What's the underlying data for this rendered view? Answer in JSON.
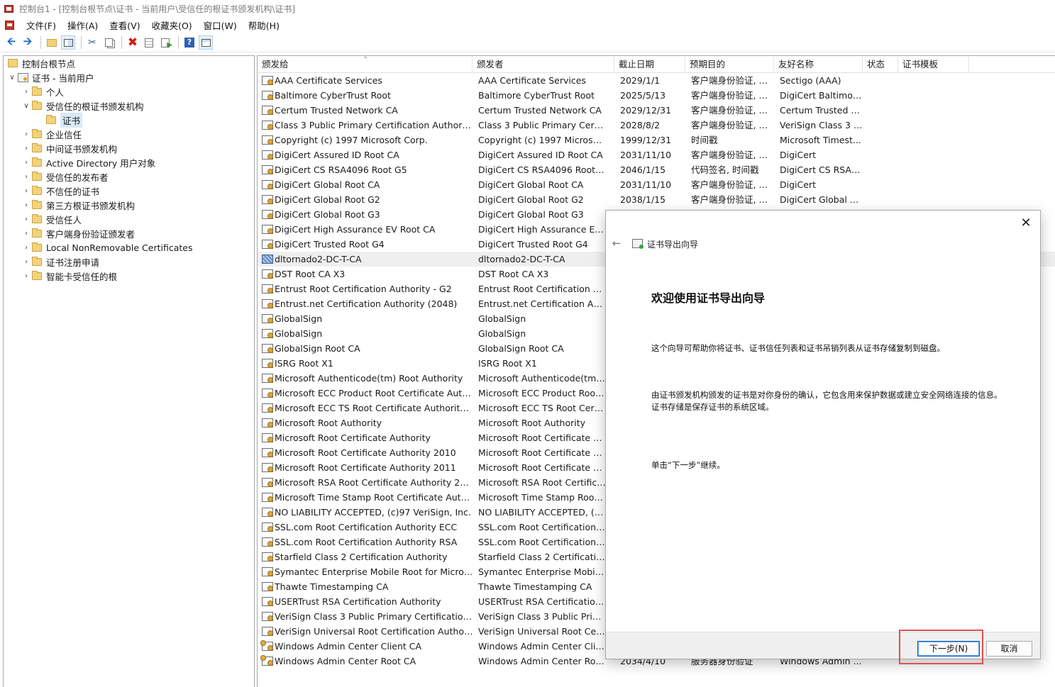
{
  "titlebar": {
    "title": "控制台1 - [控制台根节点\\证书 - 当前用户\\受信任的根证书颁发机构\\证书]"
  },
  "menubar": {
    "items": [
      "文件(F)",
      "操作(A)",
      "查看(V)",
      "收藏夹(O)",
      "窗口(W)",
      "帮助(H)"
    ]
  },
  "toolbar": {
    "icons": [
      "back-arrow-icon",
      "forward-arrow-icon",
      "up-folder-icon",
      "show-hide-tree-icon",
      "cut-icon",
      "copy-icon",
      "delete-icon",
      "properties-icon",
      "export-list-icon",
      "help-icon",
      "view-icon"
    ]
  },
  "tree": {
    "root": "控制台根节点",
    "certs_node": "证书 - 当前用户",
    "items": [
      "个人",
      "受信任的根证书颁发机构",
      "证书",
      "企业信任",
      "中间证书颁发机构",
      "Active Directory 用户对象",
      "受信任的发布者",
      "不信任的证书",
      "第三方根证书颁发机构",
      "受信任人",
      "客户端身份验证颁发者",
      "Local NonRemovable Certificates",
      "证书注册申请",
      "智能卡受信任的根"
    ]
  },
  "list": {
    "columns": [
      "颁发给",
      "颁发者",
      "截止日期",
      "预期目的",
      "友好名称",
      "状态",
      "证书模板"
    ],
    "rows": [
      [
        "AAA Certificate Services",
        "AAA Certificate Services",
        "2029/1/1",
        "客户端身份验证, 代...",
        "Sectigo (AAA)"
      ],
      [
        "Baltimore CyberTrust Root",
        "Baltimore CyberTrust Root",
        "2025/5/13",
        "客户端身份验证, 代...",
        "DigiCert Baltimor..."
      ],
      [
        "Certum Trusted Network CA",
        "Certum Trusted Network CA",
        "2029/12/31",
        "客户端身份验证, 代...",
        "Certum Trusted N..."
      ],
      [
        "Class 3 Public Primary Certification Authority",
        "Class 3 Public Primary Certifica...",
        "2028/8/2",
        "客户端身份验证, 代...",
        "VeriSign Class 3 P..."
      ],
      [
        "Copyright (c) 1997 Microsoft Corp.",
        "Copyright (c) 1997 Microsoft C...",
        "1999/12/31",
        "时间戳",
        "Microsoft Timest..."
      ],
      [
        "DigiCert Assured ID Root CA",
        "DigiCert Assured ID Root CA",
        "2031/11/10",
        "客户端身份验证, 代...",
        "DigiCert"
      ],
      [
        "DigiCert CS RSA4096 Root G5",
        "DigiCert CS RSA4096 Root G5",
        "2046/1/15",
        "代码签名, 时间戳",
        "DigiCert CS RSA4..."
      ],
      [
        "DigiCert Global Root CA",
        "DigiCert Global Root CA",
        "2031/11/10",
        "客户端身份验证, 代...",
        "DigiCert"
      ],
      [
        "DigiCert Global Root G2",
        "DigiCert Global Root G2",
        "2038/1/15",
        "客户端身份验证, 代...",
        "DigiCert Global R..."
      ],
      [
        "DigiCert Global Root G3",
        "DigiCert Global Root G3",
        "",
        "",
        ""
      ],
      [
        "DigiCert High Assurance EV Root CA",
        "DigiCert High Assurance EV R...",
        "",
        "",
        ""
      ],
      [
        "DigiCert Trusted Root G4",
        "DigiCert Trusted Root G4",
        "",
        "",
        ""
      ],
      [
        "dltornado2-DC-T-CA",
        "dltornado2-DC-T-CA",
        "",
        "",
        ""
      ],
      [
        "DST Root CA X3",
        "DST Root CA X3",
        "",
        "",
        ""
      ],
      [
        "Entrust Root Certification Authority - G2",
        "Entrust Root Certification Auth...",
        "",
        "",
        ""
      ],
      [
        "Entrust.net Certification Authority (2048)",
        "Entrust.net Certification Author...",
        "",
        "",
        ""
      ],
      [
        "GlobalSign",
        "GlobalSign",
        "",
        "",
        ""
      ],
      [
        "GlobalSign",
        "GlobalSign",
        "",
        "",
        ""
      ],
      [
        "GlobalSign Root CA",
        "GlobalSign Root CA",
        "",
        "",
        ""
      ],
      [
        "ISRG Root X1",
        "ISRG Root X1",
        "",
        "",
        ""
      ],
      [
        "Microsoft Authenticode(tm) Root Authority",
        "Microsoft Authenticode(tm) Ro...",
        "",
        "",
        ""
      ],
      [
        "Microsoft ECC Product Root Certificate Author...",
        "Microsoft ECC Product Root C...",
        "",
        "",
        ""
      ],
      [
        "Microsoft ECC TS Root Certificate Authority 20...",
        "Microsoft ECC TS Root Certific...",
        "",
        "",
        ""
      ],
      [
        "Microsoft Root Authority",
        "Microsoft Root Authority",
        "",
        "",
        ""
      ],
      [
        "Microsoft Root Certificate Authority",
        "Microsoft Root Certificate Aut...",
        "",
        "",
        ""
      ],
      [
        "Microsoft Root Certificate Authority 2010",
        "Microsoft Root Certificate Aut...",
        "",
        "",
        ""
      ],
      [
        "Microsoft Root Certificate Authority 2011",
        "Microsoft Root Certificate Aut...",
        "",
        "",
        ""
      ],
      [
        "Microsoft RSA Root Certificate Authority 2017",
        "Microsoft RSA Root Certificate...",
        "",
        "",
        ""
      ],
      [
        "Microsoft Time Stamp Root Certificate Authori...",
        "Microsoft Time Stamp Root C...",
        "",
        "",
        ""
      ],
      [
        "NO LIABILITY ACCEPTED, (c)97 VeriSign, Inc.",
        "NO LIABILITY ACCEPTED, (c)97...",
        "",
        "",
        ""
      ],
      [
        "SSL.com Root Certification Authority ECC",
        "SSL.com Root Certification Aut...",
        "",
        "",
        ""
      ],
      [
        "SSL.com Root Certification Authority RSA",
        "SSL.com Root Certification Aut...",
        "",
        "",
        ""
      ],
      [
        "Starfield Class 2 Certification Authority",
        "Starfield Class 2 Certification A...",
        "",
        "",
        ""
      ],
      [
        "Symantec Enterprise Mobile Root for Microsoft",
        "Symantec Enterprise Mobile R...",
        "",
        "",
        ""
      ],
      [
        "Thawte Timestamping CA",
        "Thawte Timestamping CA",
        "",
        "",
        ""
      ],
      [
        "USERTrust RSA Certification Authority",
        "USERTrust RSA Certification Au...",
        "",
        "",
        ""
      ],
      [
        "VeriSign Class 3 Public Primary Certification A...",
        "VeriSign Class 3 Public Primary...",
        "",
        "",
        ""
      ],
      [
        "VeriSign Universal Root Certification Authority",
        "VeriSign Universal Root Certifi...",
        "",
        "",
        ""
      ],
      [
        "Windows Admin Center Client CA",
        "Windows Admin Center Client ...",
        "",
        "",
        ""
      ],
      [
        "Windows Admin Center Root CA",
        "Windows Admin Center Root CA",
        "2034/4/10",
        "服务器身份验证",
        "Windows Admin ..."
      ]
    ]
  },
  "wizard": {
    "title": "证书导出向导",
    "heading": "欢迎使用证书导出向导",
    "para1": "这个向导可帮助你将证书、证书信任列表和证书吊销列表从证书存储复制到磁盘。",
    "para2": "由证书颁发机构颁发的证书是对你身份的确认，它包含用来保护数据或建立安全网络连接的信息。证书存储是保存证书的系统区域。",
    "para3": "单击“下一步”继续。",
    "next_label": "下一步(N)",
    "cancel_label": "取消",
    "close_glyph": "✕",
    "back_glyph": "←"
  },
  "colors": {
    "highlight": "#e05050",
    "selection": "#d9e8f7",
    "primary_button_border": "#0a64c8"
  }
}
